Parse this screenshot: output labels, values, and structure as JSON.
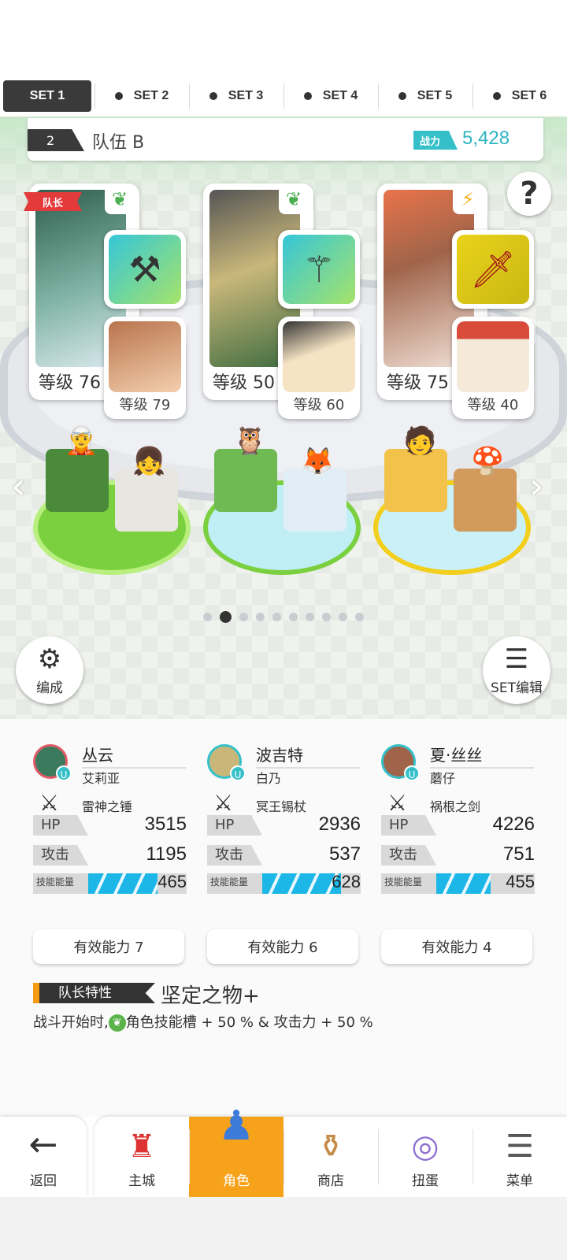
{
  "set_tabs": [
    {
      "label": "SET 1",
      "active": true
    },
    {
      "label": "SET 2",
      "active": false
    },
    {
      "label": "SET 3",
      "active": false
    },
    {
      "label": "SET 4",
      "active": false
    },
    {
      "label": "SET 5",
      "active": false
    },
    {
      "label": "SET 6",
      "active": false
    }
  ],
  "team": {
    "number": "2",
    "name": "队伍 B",
    "power_label": "战力",
    "power_value": "5,428"
  },
  "leader_tag": "队长",
  "characters": [
    {
      "level": "等级 76",
      "element_icon": "leaf-icon",
      "weapon_icon": "hammer-icon",
      "sub_level": "等级 79",
      "sub_icon": "star-icon"
    },
    {
      "level": "等级 50",
      "element_icon": "leaf-icon",
      "weapon_icon": "staff-icon",
      "sub_level": "等级 60",
      "sub_icon": "water-icon"
    },
    {
      "level": "等级 75",
      "element_icon": "lightning-icon",
      "weapon_icon": "sword-icon",
      "sub_level": "等级 40",
      "sub_icon": "fire-icon"
    }
  ],
  "help_label": "?",
  "pager": {
    "count": 10,
    "active": 1
  },
  "buttons": {
    "formation": "编成",
    "set_edit": "SET编辑"
  },
  "members": [
    {
      "name": "丛云",
      "sub": "艾莉亚",
      "weapon": "雷神之锤",
      "hp_label": "HP",
      "hp": "3515",
      "atk_label": "攻击",
      "atk": "1195",
      "energy_label": "技能能量",
      "energy": "465",
      "energy_fill": 0.7,
      "effective": "有效能力 7"
    },
    {
      "name": "波吉特",
      "sub": "白乃",
      "weapon": "冥王锡杖",
      "hp_label": "HP",
      "hp": "2936",
      "atk_label": "攻击",
      "atk": "537",
      "energy_label": "技能能量",
      "energy": "628",
      "energy_fill": 0.8,
      "effective": "有效能力 6"
    },
    {
      "name": "夏·丝丝",
      "sub": "蘑仔",
      "weapon": "祸根之剑",
      "hp_label": "HP",
      "hp": "4226",
      "atk_label": "攻击",
      "atk": "751",
      "energy_label": "技能能量",
      "energy": "455",
      "energy_fill": 0.55,
      "effective": "有效能力 4"
    }
  ],
  "leader_trait": {
    "label": "队长特性",
    "name": "坚定之物+",
    "desc_prefix": "战斗开始时,",
    "desc_suffix": "角色技能槽 + 50 % & 攻击力 + 50 %"
  },
  "nav": {
    "back": "返回",
    "items": [
      {
        "label": "主城",
        "icon": "castle-icon",
        "active": false
      },
      {
        "label": "角色",
        "icon": "character-icon",
        "active": true
      },
      {
        "label": "商店",
        "icon": "shop-icon",
        "active": false
      },
      {
        "label": "扭蛋",
        "icon": "gacha-icon",
        "active": false
      },
      {
        "label": "菜单",
        "icon": "menu-icon",
        "active": false
      }
    ]
  }
}
